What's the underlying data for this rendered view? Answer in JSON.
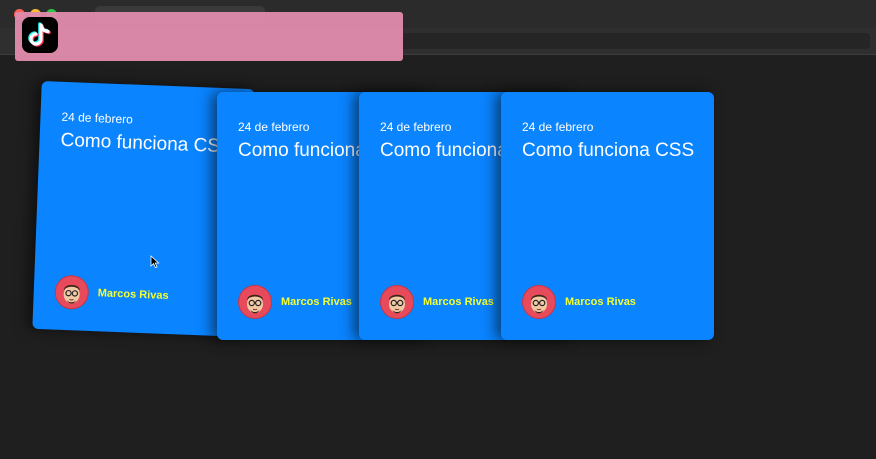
{
  "cards": [
    {
      "date": "24 de febrero",
      "title": "Como funciona CSS",
      "author": "Marcos Rivas"
    },
    {
      "date": "24 de febrero",
      "title": "Como funciona CSS",
      "author": "Marcos Rivas"
    },
    {
      "date": "24 de febrero",
      "title": "Como funciona CSS",
      "author": "Marcos Rivas"
    },
    {
      "date": "24 de febrero",
      "title": "Como funciona CSS",
      "author": "Marcos Rivas"
    }
  ],
  "colors": {
    "background": "#1f1f1f",
    "card": "#0a84ff",
    "author_name": "#f4ff33",
    "avatar_ring": "#e74a5a",
    "banner": "#e08aac"
  },
  "icons": {
    "watermark": "tiktok-logo-icon",
    "avatar": "memoji-avatar-icon",
    "pointer": "mouse-cursor-icon"
  }
}
